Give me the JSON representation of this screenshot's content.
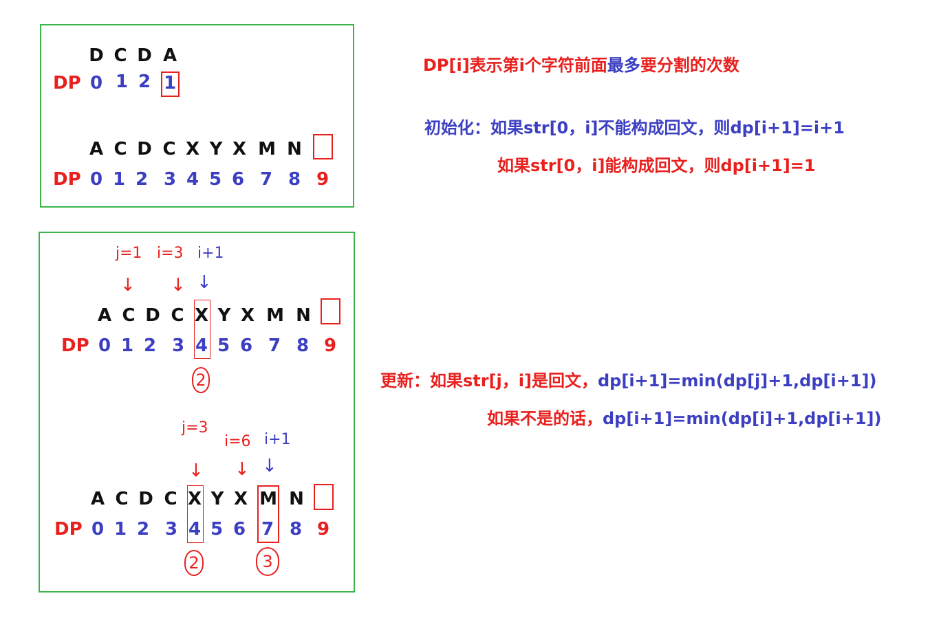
{
  "dp_label": "DP",
  "example1": {
    "chars": [
      "D",
      "C",
      "D",
      "A"
    ],
    "dp": [
      "0",
      "1",
      "2",
      "1"
    ]
  },
  "example2": {
    "chars": [
      "A",
      "C",
      "D",
      "C",
      "X",
      "Y",
      "X",
      "M",
      "N"
    ],
    "dp": [
      "0",
      "1",
      "2",
      "3",
      "4",
      "5",
      "6",
      "7",
      "8",
      "9"
    ]
  },
  "update_example1": {
    "chars": [
      "A",
      "C",
      "D",
      "C",
      "X",
      "Y",
      "X",
      "M",
      "N"
    ],
    "dp": [
      "0",
      "1",
      "2",
      "3",
      "4",
      "5",
      "6",
      "7",
      "8",
      "9"
    ],
    "annotations": {
      "j": "j=1",
      "i": "i=3",
      "i_plus": "i+1"
    },
    "circled": "2"
  },
  "update_example2": {
    "chars": [
      "A",
      "C",
      "D",
      "C",
      "X",
      "Y",
      "X",
      "M",
      "N"
    ],
    "dp": [
      "0",
      "1",
      "2",
      "3",
      "4",
      "5",
      "6",
      "7",
      "8",
      "9"
    ],
    "annotations": {
      "j": "j=3",
      "i": "i=6",
      "i_plus": "i+1"
    },
    "circled_a": "2",
    "circled_b": "3"
  },
  "notes": {
    "definition_red": "DP[i]表示第i个字符前面",
    "definition_blue": "最多",
    "definition_red2": "要分割的次数",
    "init_line1": "初始化：如果str[0，i]不能构成回文，则dp[i+1]=i+1",
    "init_line2": "如果str[0，i]能构成回文，则dp[i+1]=1",
    "update_prefix": "更新：如果str[j，i]是回文，",
    "update_formula1": "dp[i+1]=min(dp[j]+1,dp[i+1])",
    "update_line2_prefix": "如果不是的话，",
    "update_formula2": "dp[i+1]=min(dp[i]+1,dp[i+1])"
  },
  "colors": {
    "red": "#e8201e",
    "blue": "#3c3fc2",
    "green": "#3bb54a",
    "black": "#111111"
  }
}
